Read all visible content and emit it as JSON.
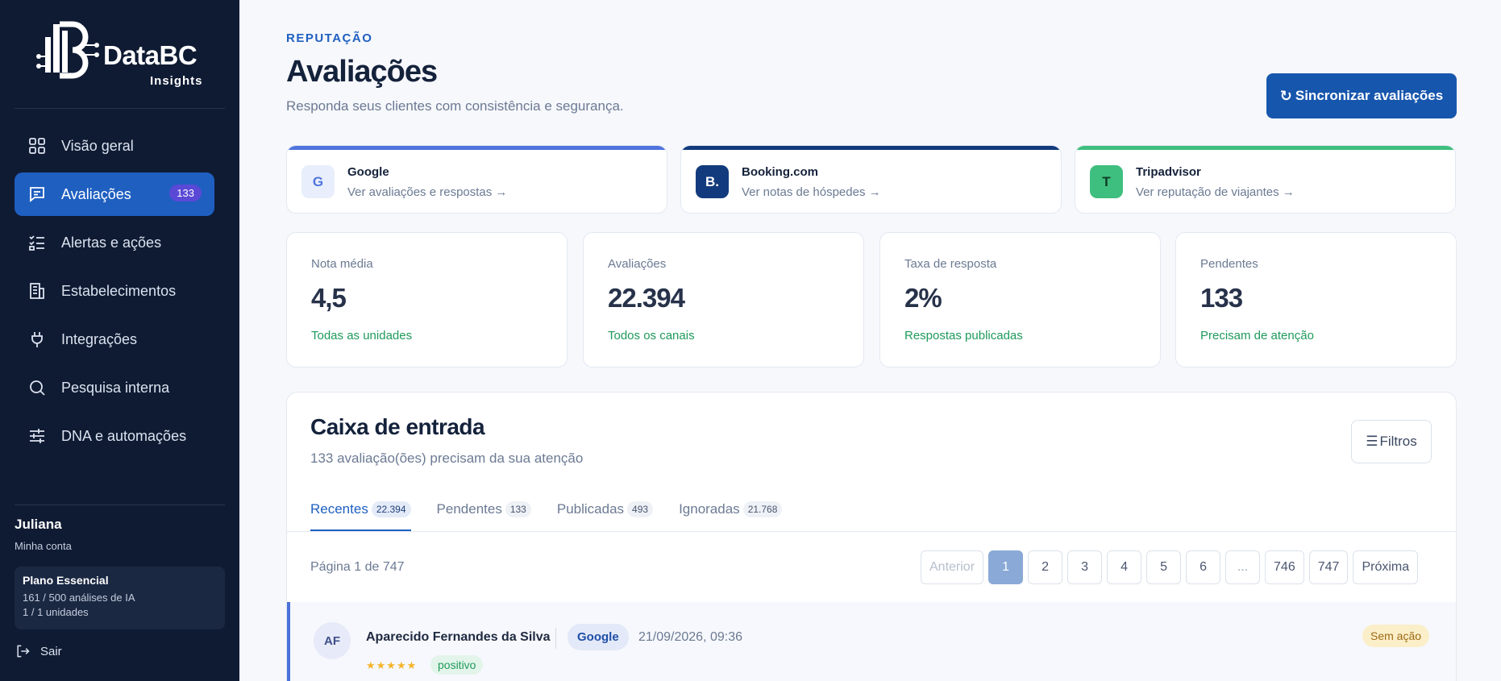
{
  "brand": {
    "name": "DataBC",
    "sub": "Insights"
  },
  "nav": [
    {
      "label": "Visão geral",
      "icon": "grid-icon"
    },
    {
      "label": "Avaliações",
      "icon": "message-icon",
      "badge": "133",
      "active": true
    },
    {
      "label": "Alertas e ações",
      "icon": "checklist-icon"
    },
    {
      "label": "Estabelecimentos",
      "icon": "building-icon"
    },
    {
      "label": "Integrações",
      "icon": "plug-icon"
    },
    {
      "label": "Pesquisa interna",
      "icon": "search-icon"
    },
    {
      "label": "DNA e automações",
      "icon": "sliders-icon"
    }
  ],
  "user": {
    "name": "Juliana",
    "sub": "Minha conta"
  },
  "plan": {
    "title": "Plano Essencial",
    "line1": "161 / 500 análises de IA",
    "line2": "1 / 1 unidades"
  },
  "logout": "Sair",
  "header": {
    "eyebrow": "REPUTAÇÃO",
    "title": "Avaliações",
    "subtitle": "Responda seus clientes com consistência e segurança.",
    "sync_label": "Sincronizar avaliações"
  },
  "platforms": [
    {
      "name": "Google",
      "link": "Ver avaliações e respostas →",
      "icon_text": "G",
      "color": "#4f74dd"
    },
    {
      "name": "Booking.com",
      "link": "Ver notas de hóspedes →",
      "icon_text": "B.",
      "color": "#123b7d"
    },
    {
      "name": "Tripadvisor",
      "link": "Ver reputação de viajantes →",
      "icon_text": "T",
      "color": "#3fbf7f"
    }
  ],
  "kpis": [
    {
      "label": "Nota média",
      "value": "4,5",
      "note": "Todas as unidades"
    },
    {
      "label": "Avaliações",
      "value": "22.394",
      "note": "Todos os canais"
    },
    {
      "label": "Taxa de resposta",
      "value": "2%",
      "note": "Respostas publicadas"
    },
    {
      "label": "Pendentes",
      "value": "133",
      "note": "Precisam de atenção"
    }
  ],
  "inbox": {
    "title": "Caixa de entrada",
    "subtitle": "133 avaliação(ões) precisam da sua atenção",
    "filter_label": "Filtros",
    "tabs": [
      {
        "label": "Recentes",
        "count": "22.394",
        "active": true
      },
      {
        "label": "Pendentes",
        "count": "133"
      },
      {
        "label": "Publicadas",
        "count": "493"
      },
      {
        "label": "Ignoradas",
        "count": "21.768"
      }
    ],
    "page_info": "Página 1 de 747",
    "pager": {
      "prev": "Anterior",
      "pages": [
        "1",
        "2",
        "3",
        "4",
        "5",
        "6",
        "...",
        "746",
        "747"
      ],
      "current": "1",
      "next": "Próxima"
    }
  },
  "review": {
    "initials": "AF",
    "name": "Aparecido Fernandes da Silva",
    "source": "Google",
    "date": "21/09/2026, 09:36",
    "stars": "★★★★★",
    "sentiment": "positivo",
    "status": "Sem ação"
  }
}
